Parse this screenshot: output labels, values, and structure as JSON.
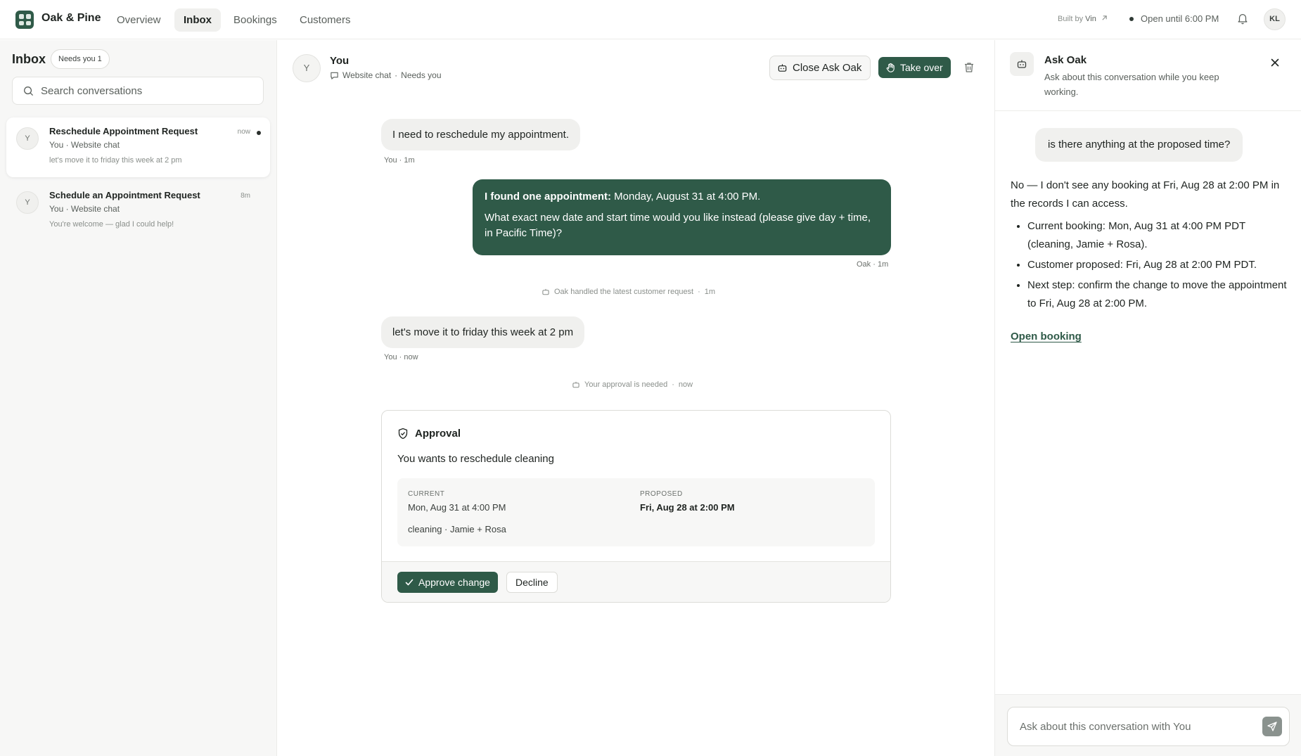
{
  "topbar": {
    "brand": "Oak & Pine",
    "nav": [
      "Overview",
      "Inbox",
      "Bookings",
      "Customers"
    ],
    "active_nav": "Inbox",
    "built_by_prefix": "Built by",
    "built_by_name": "Vin",
    "open_status": "Open until 6:00 PM",
    "user_initials": "KL",
    "accent_color": "#2f5a48"
  },
  "sidebar": {
    "title": "Inbox",
    "needs_badge": "Needs you 1",
    "search_placeholder": "Search conversations",
    "conversations": [
      {
        "avatar": "Y",
        "title": "Reschedule Appointment Request",
        "sub": "You · Website chat",
        "preview": "let's move it to friday this week at 2 pm",
        "time": "now",
        "unread": true
      },
      {
        "avatar": "Y",
        "title": "Schedule an Appointment Request",
        "sub": "You · Website chat",
        "preview": "You're welcome — glad I could help!",
        "time": "8m",
        "unread": false
      }
    ]
  },
  "conversation": {
    "avatar": "Y",
    "name": "You",
    "channel": "Website chat",
    "status": "Needs you",
    "close_ask_oak_label": "Close Ask Oak",
    "take_over_label": "Take over",
    "messages": {
      "m1": {
        "text": "I need to reschedule my appointment.",
        "meta": "You · 1m"
      },
      "m2": {
        "lead": "I found one appointment:",
        "lead_rest": " Monday, August 31 at 4:00 PM.",
        "body": "What exact new date and start time would you like instead (please give day + time, in Pacific Time)?",
        "meta": "Oak · 1m"
      },
      "sys1": {
        "text": "Oak handled the latest customer request",
        "time": "1m"
      },
      "m3": {
        "text": "let's move it to friday this week at 2 pm",
        "meta": "You · now"
      },
      "sys2": {
        "text": "Your approval is needed",
        "time": "now"
      }
    },
    "approval": {
      "title": "Approval",
      "description": "You wants to reschedule cleaning",
      "current_label": "CURRENT",
      "current_value": "Mon, Aug 31 at 4:00 PM",
      "proposed_label": "PROPOSED",
      "proposed_value": "Fri, Aug 28 at 2:00 PM",
      "details": "cleaning · Jamie + Rosa",
      "approve_label": "Approve change",
      "decline_label": "Decline"
    }
  },
  "ask_oak": {
    "title": "Ask Oak",
    "description": "Ask about this conversation while you keep working.",
    "user_question": "is there anything at the proposed time?",
    "answer_intro": "No — I don't see any booking at Fri, Aug 28 at 2:00 PM in the records I can access.",
    "answer_points": [
      "Current booking: Mon, Aug 31 at 4:00 PM PDT (cleaning, Jamie + Rosa).",
      "Customer proposed: Fri, Aug 28 at 2:00 PM PDT.",
      "Next step: confirm the change to move the appointment to Fri, Aug 28 at 2:00 PM."
    ],
    "link": "Open booking",
    "input_placeholder": "Ask about this conversation with You"
  }
}
